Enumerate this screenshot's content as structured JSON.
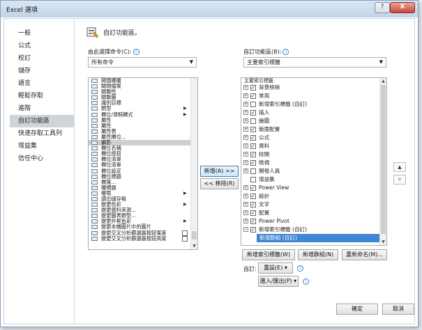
{
  "window": {
    "title": "Excel 選項",
    "help_label": "?",
    "close_label": "X"
  },
  "nav": {
    "items": [
      "一般",
      "公式",
      "校訂",
      "儲存",
      "語言",
      "輕鬆存取",
      "進階",
      "自訂功能區",
      "快速存取工具列",
      "增益集",
      "信任中心"
    ],
    "selected_index": 7
  },
  "page": {
    "title": "自訂功能區。",
    "choose_from_label": "由此選擇命令(C):",
    "choose_from_value": "所有命令",
    "customize_label": "自訂功能區(B):",
    "customize_value": "主要索引標籤"
  },
  "commands": [
    {
      "label": "開闊樓層"
    },
    {
      "label": "關閉檔案"
    },
    {
      "label": "關聯性"
    },
    {
      "label": "關聯圖"
    },
    {
      "label": "識別目標"
    },
    {
      "label": "類型",
      "submenu": true
    },
    {
      "label": "欄位/滑騎欄式",
      "submenu": true
    },
    {
      "label": "屬性"
    },
    {
      "label": "屬性"
    },
    {
      "label": "屬性表"
    },
    {
      "label": "屬性欄位..."
    },
    {
      "label": "攝影",
      "selected": true
    },
    {
      "label": "欄位名稱"
    },
    {
      "label": "欄位按鈕"
    },
    {
      "label": "欄位清單"
    },
    {
      "label": "欄位清單"
    },
    {
      "label": "欄位設定"
    },
    {
      "label": "欄位標題"
    },
    {
      "label": "欄寬..."
    },
    {
      "label": "權標題"
    },
    {
      "label": "權限",
      "submenu": true
    },
    {
      "label": "讀出儲存格"
    },
    {
      "label": "變更色彩",
      "submenu": true
    },
    {
      "label": "變更資料來源..."
    },
    {
      "label": "變更圖表類型..."
    },
    {
      "label": "變更外框色彩",
      "submenu": true
    },
    {
      "label": "變更本機圖片中的圖片"
    },
    {
      "label": "變更交叉分析篩選器按鈕寬度",
      "box": true
    },
    {
      "label": "變更交叉分析篩選器按鈕高度",
      "box": true
    }
  ],
  "tree": [
    {
      "label": "主要索引標籤",
      "header": true
    },
    {
      "label": "背景移除",
      "expand": "+",
      "checked": true
    },
    {
      "label": "常用",
      "expand": "+",
      "checked": true
    },
    {
      "label": "新增索引標籤 (自訂)",
      "expand": "+",
      "checked": false
    },
    {
      "label": "插入",
      "expand": "+",
      "checked": true
    },
    {
      "label": "繪圖",
      "expand": "+",
      "checked": false
    },
    {
      "label": "版面配置",
      "expand": "+",
      "checked": true
    },
    {
      "label": "公式",
      "expand": "+",
      "checked": true
    },
    {
      "label": "資料",
      "expand": "+",
      "checked": true
    },
    {
      "label": "校閱",
      "expand": "+",
      "checked": true
    },
    {
      "label": "檢視",
      "expand": "+",
      "checked": true
    },
    {
      "label": "開發人員",
      "expand": "+",
      "checked": false
    },
    {
      "label": "增益集",
      "expand": "",
      "checked": false
    },
    {
      "label": "Power View",
      "expand": "+",
      "checked": true
    },
    {
      "label": "設計",
      "expand": "+",
      "checked": true
    },
    {
      "label": "文字",
      "expand": "+",
      "checked": true
    },
    {
      "label": "配置",
      "expand": "+",
      "checked": true
    },
    {
      "label": "Power Pivot",
      "expand": "+",
      "checked": true
    },
    {
      "label": "新增索引標籤 (自訂)",
      "expand": "−",
      "checked": true
    },
    {
      "label": "新增群組 (自訂)",
      "child": true,
      "selected": true
    }
  ],
  "buttons": {
    "add": "新增(A) >>",
    "remove": "<< 移除(R)",
    "new_tab": "新增索引標籤(W)",
    "new_group": "新增群組(N)",
    "rename": "重新命名(M)...",
    "customizations_label": "自訂:",
    "reset": "重設(E) ▾",
    "import_export": "匯入/匯出(P) ▾",
    "ok": "確定",
    "cancel": "取消",
    "move_up": "▲",
    "move_down": "▼"
  }
}
